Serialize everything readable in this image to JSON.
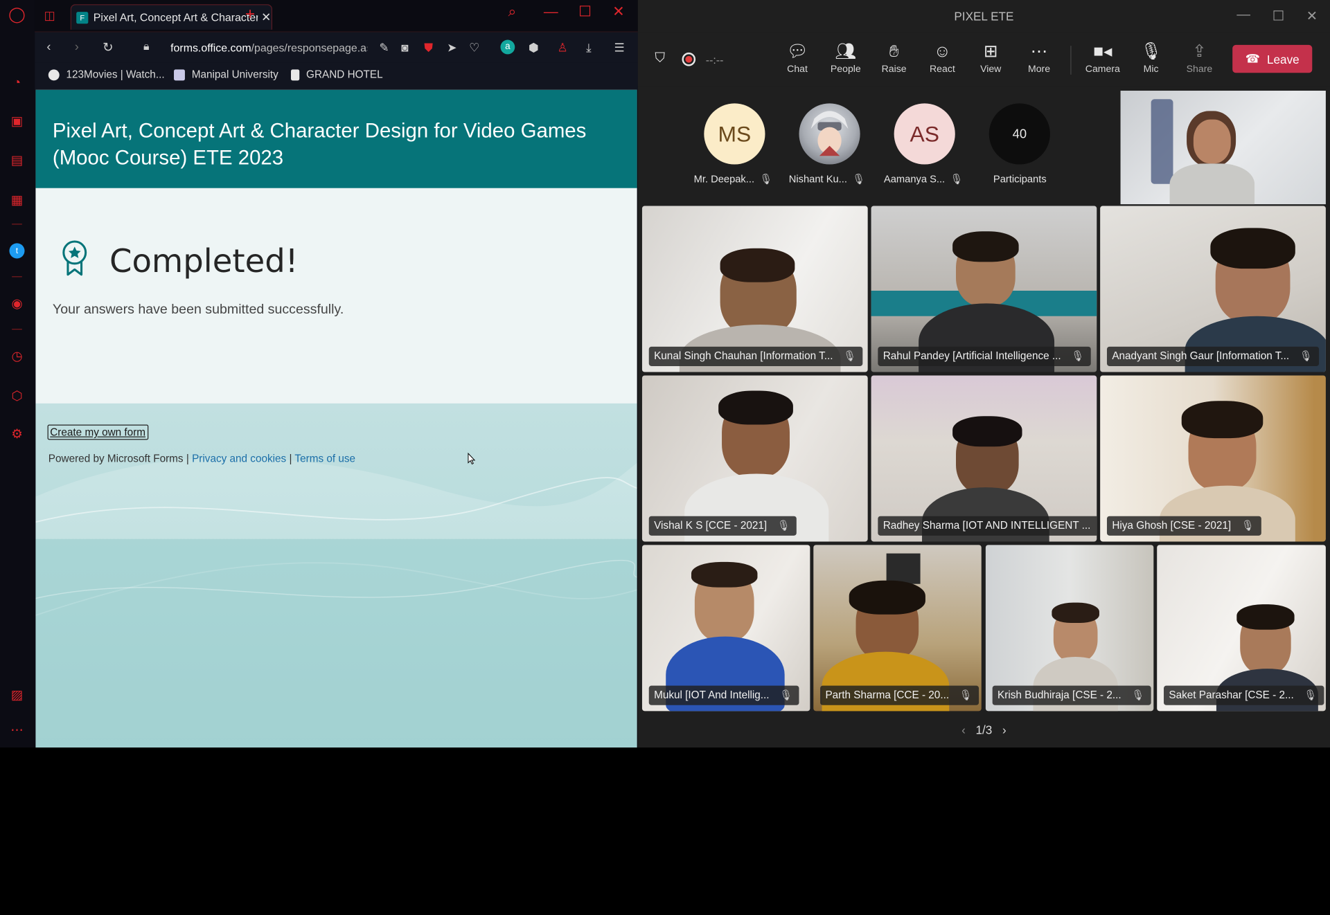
{
  "browser": {
    "tab_title": "Pixel Art, Concept Art & Character Design",
    "tab_favicon": "F",
    "url_domain": "forms.office.com",
    "url_path": "/pages/responsepage.aspx",
    "bookmarks": [
      "123Movies | Watch...",
      "Manipal University",
      "GRAND HOTEL"
    ],
    "accent": "#e0262c"
  },
  "form": {
    "title": "Pixel Art, Concept Art & Character Design for Video Games (Mooc Course) ETE 2023",
    "completed_title": "Completed!",
    "completed_message": "Your answers have been submitted successfully.",
    "create_form_label": "Create my own form",
    "powered_by": "Powered by Microsoft Forms |",
    "privacy_label": "Privacy and cookies",
    "separator": "|",
    "terms_label": "Terms of use",
    "header_color": "#067479"
  },
  "teams": {
    "window_title": "PIXEL ETE",
    "timer": "--:--",
    "tools": {
      "chat": "Chat",
      "people": "People",
      "raise": "Raise",
      "react": "React",
      "view": "View",
      "more": "More",
      "camera": "Camera",
      "mic": "Mic",
      "share": "Share"
    },
    "leave_label": "Leave",
    "leave_color": "#c4314b",
    "participants": [
      {
        "initials": "MS",
        "name": "Mr. Deepak..."
      },
      {
        "initials": "",
        "name": "Nishant Ku..."
      },
      {
        "initials": "AS",
        "name": "Aamanya S..."
      }
    ],
    "participant_count": "40",
    "participant_count_label": "Participants",
    "videos": [
      "Kunal Singh Chauhan [Information T...",
      "Rahul Pandey [Artificial Intelligence ...",
      "Anadyant Singh Gaur [Information T...",
      "Vishal K S [CCE - 2021]",
      "Radhey Sharma [IOT AND INTELLIGENT ...",
      "Hiya Ghosh [CSE - 2021]",
      "Mukul [IOT And Intellig...",
      "Parth Sharma [CCE - 20...",
      "Krish Budhiraja [CSE - 2...",
      "Saket Parashar [CSE - 2..."
    ],
    "pager": "1/3"
  }
}
